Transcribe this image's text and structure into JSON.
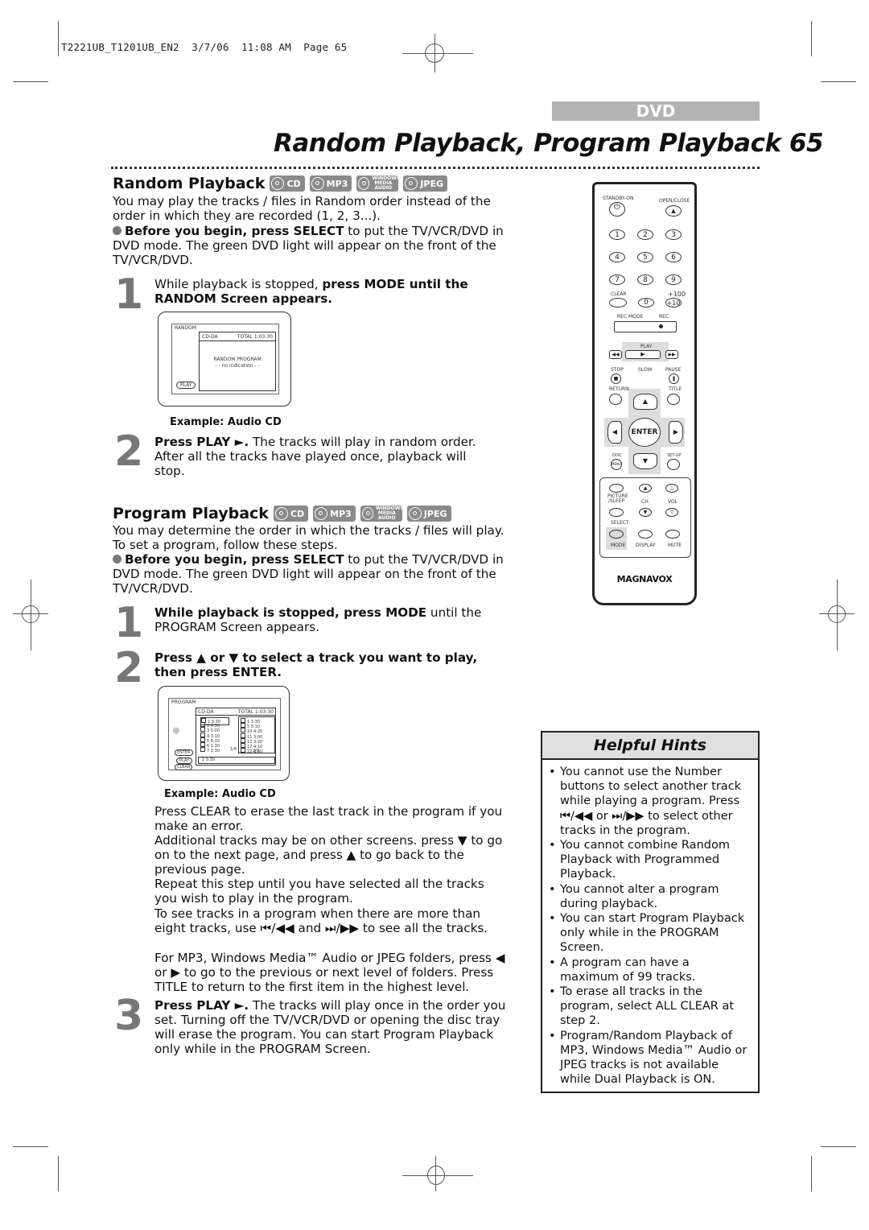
{
  "slug": "T2221UB_T1201UB_EN2  3/7/06  11:08 AM  Page 65",
  "section_badge": "DVD",
  "page_title": "Random Playback, Program Playback  65",
  "disc_icons": [
    "CD",
    "MP3",
    "WINDOWS MEDIA AUDIO",
    "JPEG"
  ],
  "random": {
    "heading": "Random Playback",
    "intro": "You may play the tracks / files in Random order instead of the order in which they are recorded (1, 2, 3...).",
    "before_bold": "Before you begin, press SELECT",
    "before_rest": " to put the TV/VCR/DVD in DVD mode. The green DVD light will appear on the front of the TV/VCR/DVD.",
    "step1_num": "1",
    "step1_plain": "While playback is stopped, ",
    "step1_bold": "press MODE until the RANDOM Screen appears.",
    "screen": {
      "title": "RANDOM",
      "disc_type": "CD-DA",
      "total": "TOTAL 1:03:30",
      "line1": "RANDOM  PROGRAM",
      "line2": "- -  no  indication  - -",
      "button": "PLAY"
    },
    "caption": "Example: Audio CD",
    "step2_num": "2",
    "step2_bold": "Press PLAY ►.",
    "step2_rest": " The tracks will play in random order. After all the tracks have played once, playback will stop."
  },
  "program": {
    "heading": "Program Playback",
    "intro": "You may determine the order in which the tracks / files will play. To set a program, follow these steps.",
    "before_bold": "Before you begin, press SELECT",
    "before_rest": " to put the TV/VCR/DVD in DVD mode. The green DVD light will appear on the front of the TV/VCR/DVD.",
    "step1_num": "1",
    "step1_bold": "While playback is stopped, press MODE",
    "step1_rest": " until the PROGRAM Screen appears.",
    "step2_num": "2",
    "step2_bold": "Press ▲ or ▼ to select a track you want to play, then press ENTER.",
    "screen": {
      "title": "PROGRAM",
      "disc_type": "CD-DA",
      "total": "TOTAL 1:03:30",
      "left_tracks": [
        {
          "no": "1",
          "time": "3:30"
        },
        {
          "no": "2",
          "time": "4:30"
        },
        {
          "no": "3",
          "time": "5:00"
        },
        {
          "no": "4",
          "time": "3:10"
        },
        {
          "no": "5",
          "time": "6:10"
        },
        {
          "no": "6",
          "time": "1:30"
        },
        {
          "no": "7",
          "time": "2:30"
        }
      ],
      "left_page": "1/4",
      "right_tracks": [
        {
          "no": "1",
          "time": "3:30"
        },
        {
          "no": "5",
          "time": "5:10"
        },
        {
          "no": "10",
          "time": "4:20"
        },
        {
          "no": "11",
          "time": "3:00"
        },
        {
          "no": "12",
          "time": "3:20"
        },
        {
          "no": "17",
          "time": "4:10"
        },
        {
          "no": "22",
          "time": "2:50"
        }
      ],
      "right_page": "2/3",
      "bottom": "1  3:30",
      "buttons": [
        "ENTER",
        "PLAY",
        "CLEAR"
      ]
    },
    "caption": "Example: Audio CD",
    "para_clear": "Press CLEAR to erase the last track in the program if you make an error.",
    "para_additional": "Additional tracks may be on other screens. press ▼ to go on to the next page, and press ▲ to go back to the previous page.",
    "para_repeat": "Repeat this step until you have selected all the tracks you wish to play in the program.",
    "para_more": "To see tracks in a program when there are more than eight tracks, use ⏮/◀◀ and ⏭/▶▶ to see all the tracks.",
    "para_mp3": "For MP3, Windows Media™ Audio or JPEG folders, press ◀ or ▶ to go to the previous or next level of folders. Press TITLE to return to the first item in the highest level.",
    "step3_num": "3",
    "step3_bold": "Press PLAY ►.",
    "step3_rest": " The tracks will play once in the order you set. Turning off the TV/VCR/DVD or opening the disc tray will erase the program. You can start Program Playback only while in the PROGRAM Screen."
  },
  "remote": {
    "standby": "STANDBY-ON",
    "open_close": "OPEN/CLOSE",
    "digits": [
      "1",
      "2",
      "3",
      "4",
      "5",
      "6",
      "7",
      "8",
      "9"
    ],
    "clear": "CLEAR",
    "zero": "0",
    "plus100": "+100",
    "plus10": "+10",
    "rec_mode": "REC MODE",
    "rec": "REC",
    "play": "PLAY",
    "stop": "STOP",
    "slow": "SLOW",
    "pause": "PAUSE",
    "return": "RETURN",
    "title": "TITLE",
    "enter": "ENTER",
    "disc": "DISC",
    "menu": "MENU",
    "setup": "SET-UP",
    "picture_sleep": "PICTURE /SLEEP",
    "ch": "CH.",
    "vol": "VOL",
    "select": "SELECT",
    "mode": "MODE",
    "display": "DISPLAY",
    "mute": "MUTE",
    "brand": "MAGNAVOX"
  },
  "hints": {
    "title": "Helpful Hints",
    "items": [
      "You cannot use the Number buttons to select another track while playing a program. Press ⏮/◀◀ or ⏭/▶▶ to select other tracks in the program.",
      "You cannot combine Random Playback with Programmed Playback.",
      "You cannot alter a program during playback.",
      "You can start Program Playback only while in the PROGRAM Screen.",
      "A program can have a maximum of 99 tracks.",
      "To erase all tracks in the program, select ALL CLEAR at step 2.",
      "Program/Random Playback of MP3, Windows Media™ Audio or JPEG tracks is not available while Dual Playback is ON."
    ]
  }
}
